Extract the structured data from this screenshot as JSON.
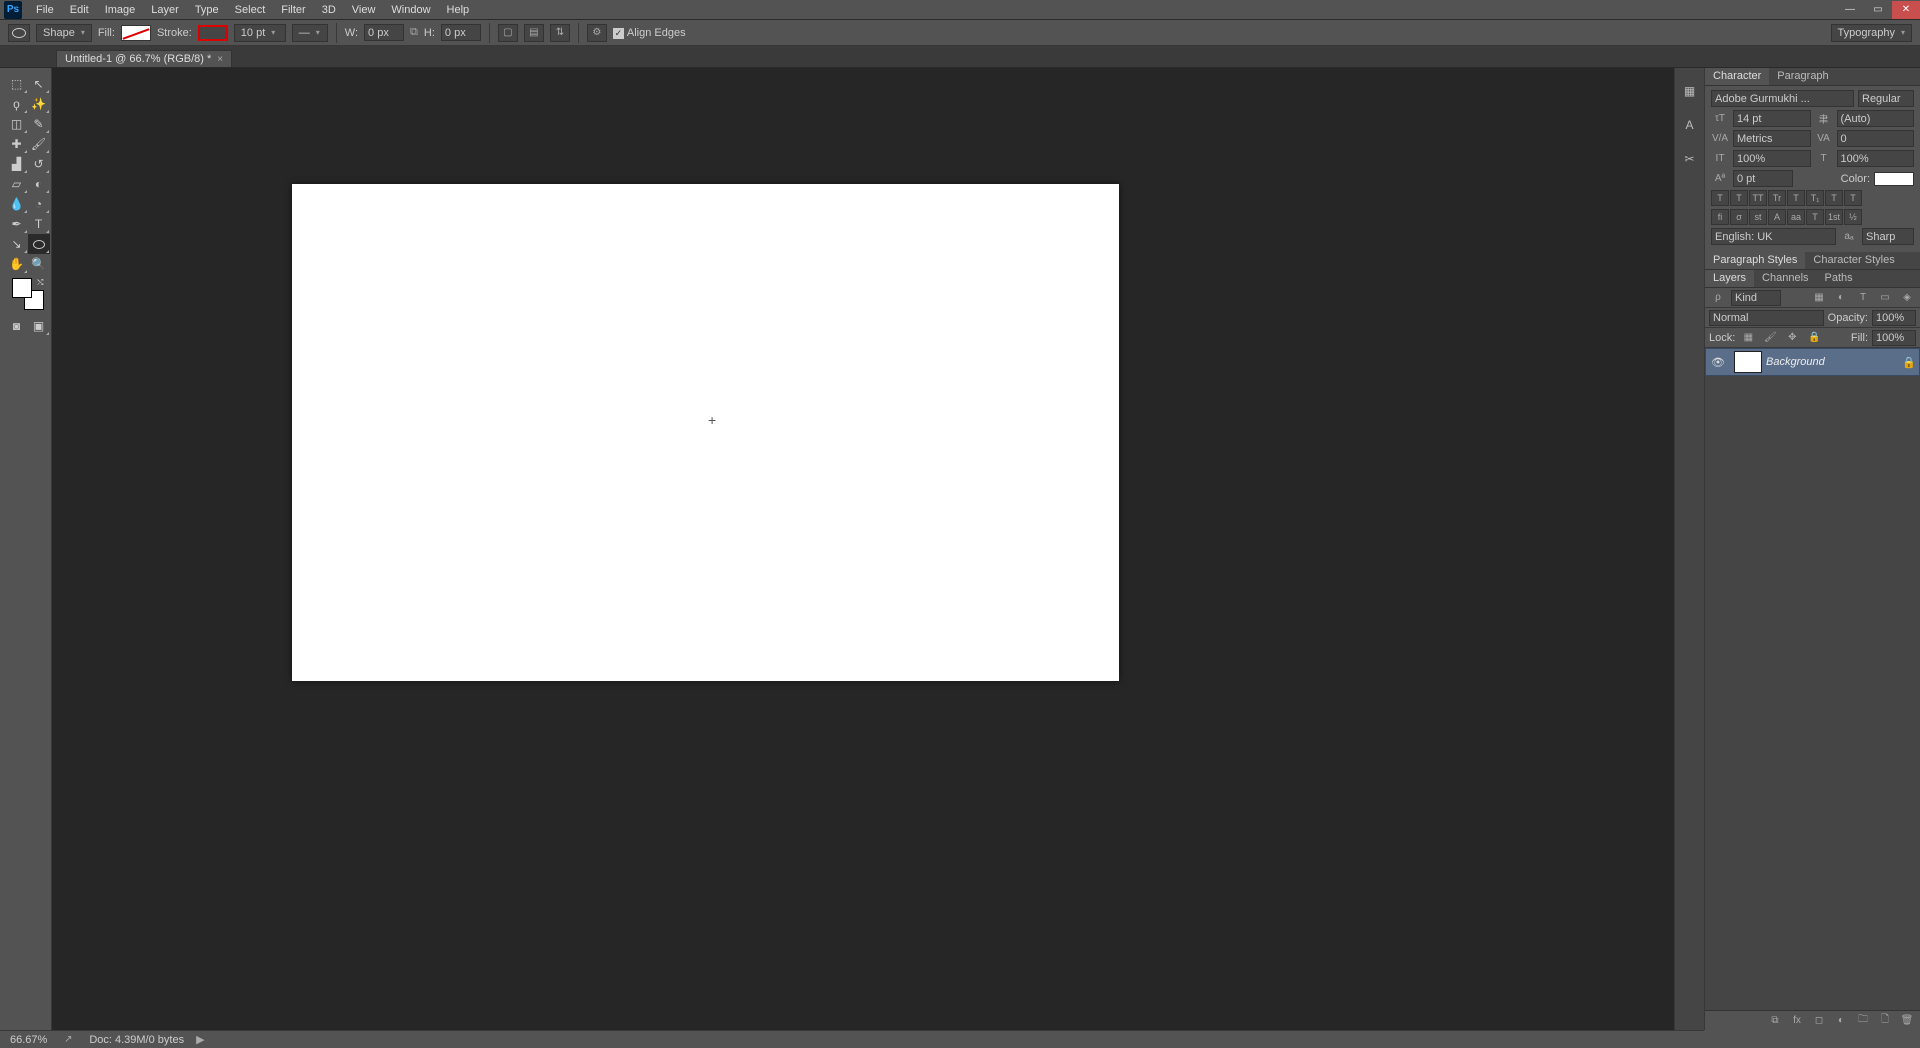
{
  "app": {
    "logo": "Ps"
  },
  "menu": {
    "items": [
      "File",
      "Edit",
      "Image",
      "Layer",
      "Type",
      "Select",
      "Filter",
      "3D",
      "View",
      "Window",
      "Help"
    ]
  },
  "window_controls": {
    "min": "—",
    "max": "▭",
    "close": "✕"
  },
  "options": {
    "tool_mode": "Shape",
    "fill_label": "Fill:",
    "stroke_label": "Stroke:",
    "stroke_width": "10 pt",
    "w_label": "W:",
    "w_val": "0 px",
    "h_label": "H:",
    "h_val": "0 px",
    "align_edges": "Align Edges",
    "workspace": "Typography"
  },
  "tab": {
    "title": "Untitled-1 @ 66.7% (RGB/8) *",
    "close": "×"
  },
  "canvas": {
    "cursor": "+"
  },
  "dock_icons": [
    "▦",
    "A",
    "✂"
  ],
  "char_panel": {
    "tab_character": "Character",
    "tab_paragraph": "Paragraph",
    "font": "Adobe Gurmukhi ...",
    "style": "Regular",
    "size": "14 pt",
    "leading": "(Auto)",
    "kerning": "Metrics",
    "tracking": "0",
    "vscale": "100%",
    "hscale": "100%",
    "baseline": "0 pt",
    "color_label": "Color:",
    "lang": "English: UK",
    "aa": "Sharp",
    "btns1": [
      "T",
      "T",
      "TT",
      "Tr",
      "T",
      "T₁",
      "T",
      "T"
    ],
    "btns2": [
      "fi",
      "σ",
      "st",
      "A",
      "aa",
      "T",
      "1st",
      "½"
    ]
  },
  "pstyles": {
    "tab1": "Paragraph Styles",
    "tab2": "Character Styles"
  },
  "layers": {
    "tab_layers": "Layers",
    "tab_channels": "Channels",
    "tab_paths": "Paths",
    "kind": "Kind",
    "blend": "Normal",
    "opacity_label": "Opacity:",
    "opacity": "100%",
    "lock_label": "Lock:",
    "fill_label": "Fill:",
    "fill": "100%",
    "layer_name": "Background"
  },
  "status": {
    "zoom": "66.67%",
    "doc": "Doc: 4.39M/0 bytes",
    "arrow": "▶"
  }
}
